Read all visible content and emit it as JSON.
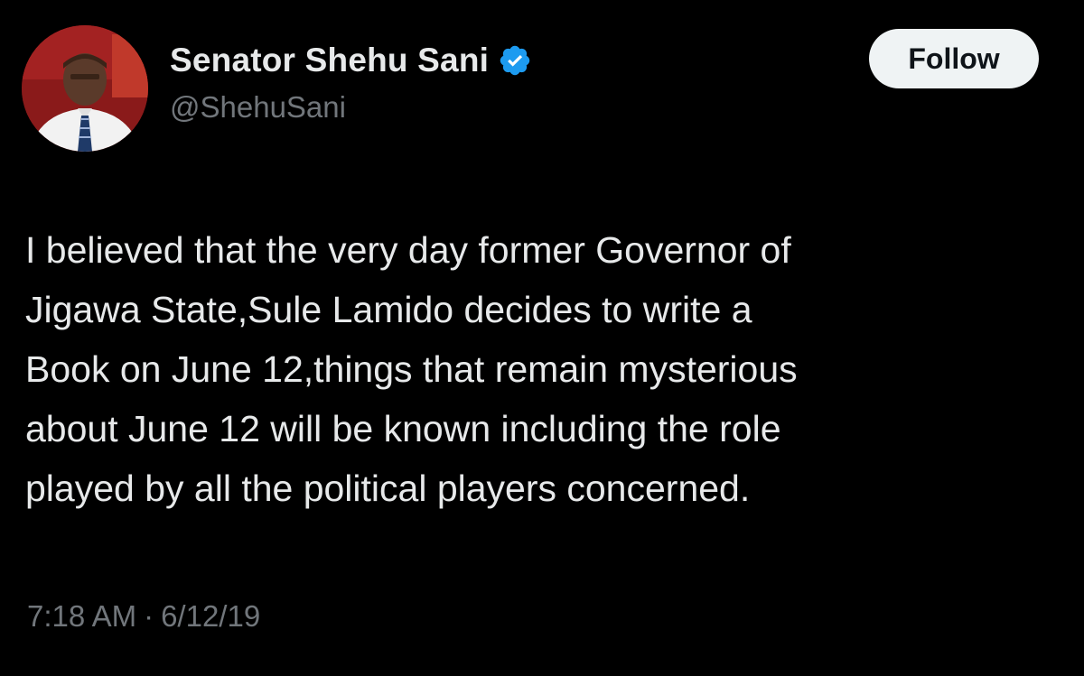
{
  "author": {
    "display_name": "Senator Shehu Sani",
    "handle": "@ShehuSani",
    "verified_icon": "verified-badge-icon",
    "verified_color": "#1d9bf0",
    "avatar_icon": "profile-photo"
  },
  "actions": {
    "follow_label": "Follow"
  },
  "tweet": {
    "lines": [
      "I believed that the very day former Governor of",
      "Jigawa State,Sule Lamido decides to write a",
      "Book on June 12,things that remain mysterious",
      "about June 12 will be known including the role",
      "played by all the political players concerned."
    ],
    "time": "7:18 AM",
    "separator": "·",
    "date": "6/12/19"
  },
  "colors": {
    "background": "#000000",
    "primary_text": "#e7e9ea",
    "secondary_text": "#71767b",
    "button_bg": "#eff3f4",
    "button_text": "#0f1419"
  }
}
